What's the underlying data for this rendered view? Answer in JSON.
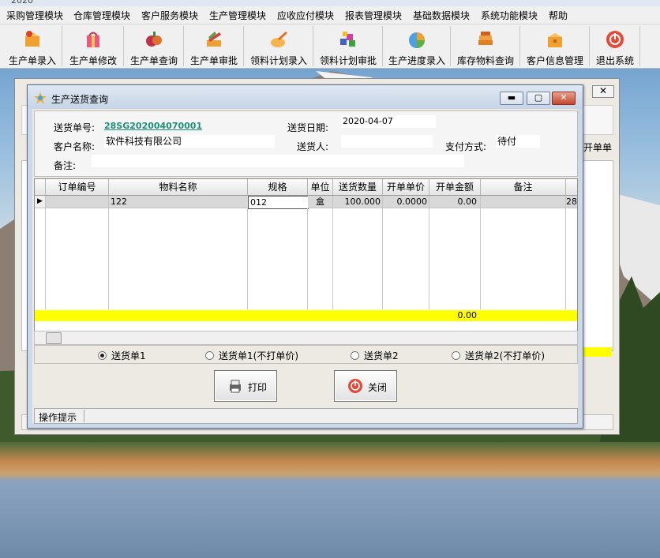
{
  "app": {
    "title_fragment": "2020"
  },
  "menu": [
    "采购管理模块",
    "仓库管理模块",
    "客户服务模块",
    "生产管理模块",
    "应收应付模块",
    "报表管理模块",
    "基础数据模块",
    "系统功能模块",
    "帮助"
  ],
  "toolbar": [
    "生产单录入",
    "生产单修改",
    "生产单查询",
    "生产单审批",
    "领料计划录入",
    "领料计划审批",
    "生产进度录入",
    "库存物料查询",
    "客户信息管理",
    "退出系统"
  ],
  "back_window": {
    "close_label": "✕",
    "header_fragment": "开单单"
  },
  "dialog": {
    "title": "生产送货查询",
    "min_label": "▬",
    "max_label": "▢",
    "close_label": "✕",
    "form": {
      "delivery_no_label": "送货单号:",
      "delivery_no": "28SG202004070001",
      "delivery_date_label": "送货日期:",
      "delivery_date": "2020-04-07",
      "customer_label": "客户名称:",
      "customer": "软件科技有限公司",
      "deliverer_label": "送货人:",
      "deliverer": "",
      "payment_label": "支付方式:",
      "payment": "待付",
      "remark_label": "备注:",
      "remark": ""
    },
    "grid": {
      "columns": [
        "订单编号",
        "物料名称",
        "规格",
        "单位",
        "送货数量",
        "开单单价",
        "开单金额",
        "备注",
        ""
      ],
      "rows": [
        {
          "order_no": "",
          "material": "122",
          "spec": "012",
          "unit": "盒",
          "qty": "100.000",
          "price": "0.0000",
          "amount": "0.00",
          "remark": "",
          "extra": "28"
        }
      ],
      "sum_amount": "0.00"
    },
    "radios": [
      {
        "label": "送货单1",
        "checked": true
      },
      {
        "label": "送货单1(不打单价)",
        "checked": false
      },
      {
        "label": "送货单2",
        "checked": false
      },
      {
        "label": "送货单2(不打单价)",
        "checked": false
      }
    ],
    "print_label": "打印",
    "close_button_label": "关闭",
    "status_label": "操作提示"
  }
}
